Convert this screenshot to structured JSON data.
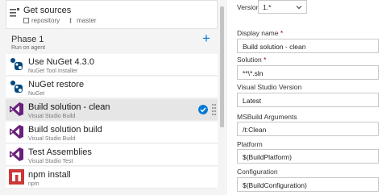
{
  "sources": {
    "title": "Get sources",
    "repo": "repository",
    "branch": "master"
  },
  "phase": {
    "title": "Phase 1",
    "subtitle": "Run on agent",
    "add_icon": "plus-icon"
  },
  "tasks": [
    {
      "name": "Use NuGet 4.3.0",
      "sub": "NuGet Tool Installer",
      "icon": "nuget-icon"
    },
    {
      "name": "NuGet restore",
      "sub": "NuGet",
      "icon": "nuget-icon"
    },
    {
      "name": "Build solution - clean",
      "sub": "Visual Studio Build",
      "icon": "visual-studio-icon",
      "selected": true
    },
    {
      "name": "Build solution build",
      "sub": "Visual Studio Build",
      "icon": "visual-studio-icon"
    },
    {
      "name": "Test Assemblies",
      "sub": "Visual Studio Test",
      "icon": "visual-studio-test-icon"
    },
    {
      "name": "npm install",
      "sub": "npm",
      "icon": "npm-icon"
    }
  ],
  "form": {
    "version_label": "Version",
    "version_value": "1.*",
    "display_name_label": "Display name",
    "display_name_value": "Build solution - clean",
    "solution_label": "Solution",
    "solution_value": "**\\*.sln",
    "vs_version_label": "Visual Studio Version",
    "vs_version_value": "Latest",
    "msbuild_label": "MSBuild Arguments",
    "msbuild_value": "/t:Clean",
    "platform_label": "Platform",
    "platform_value": "$(BuildPlatform)",
    "configuration_label": "Configuration",
    "configuration_value": "$(BuildConfiguration)",
    "required_marker": "*"
  },
  "colors": {
    "accent": "#0078d4",
    "nuget_blue": "#004880",
    "vs_purple": "#68217a",
    "npm_red": "#cb3837",
    "selected_bg": "#e6e6e6"
  }
}
